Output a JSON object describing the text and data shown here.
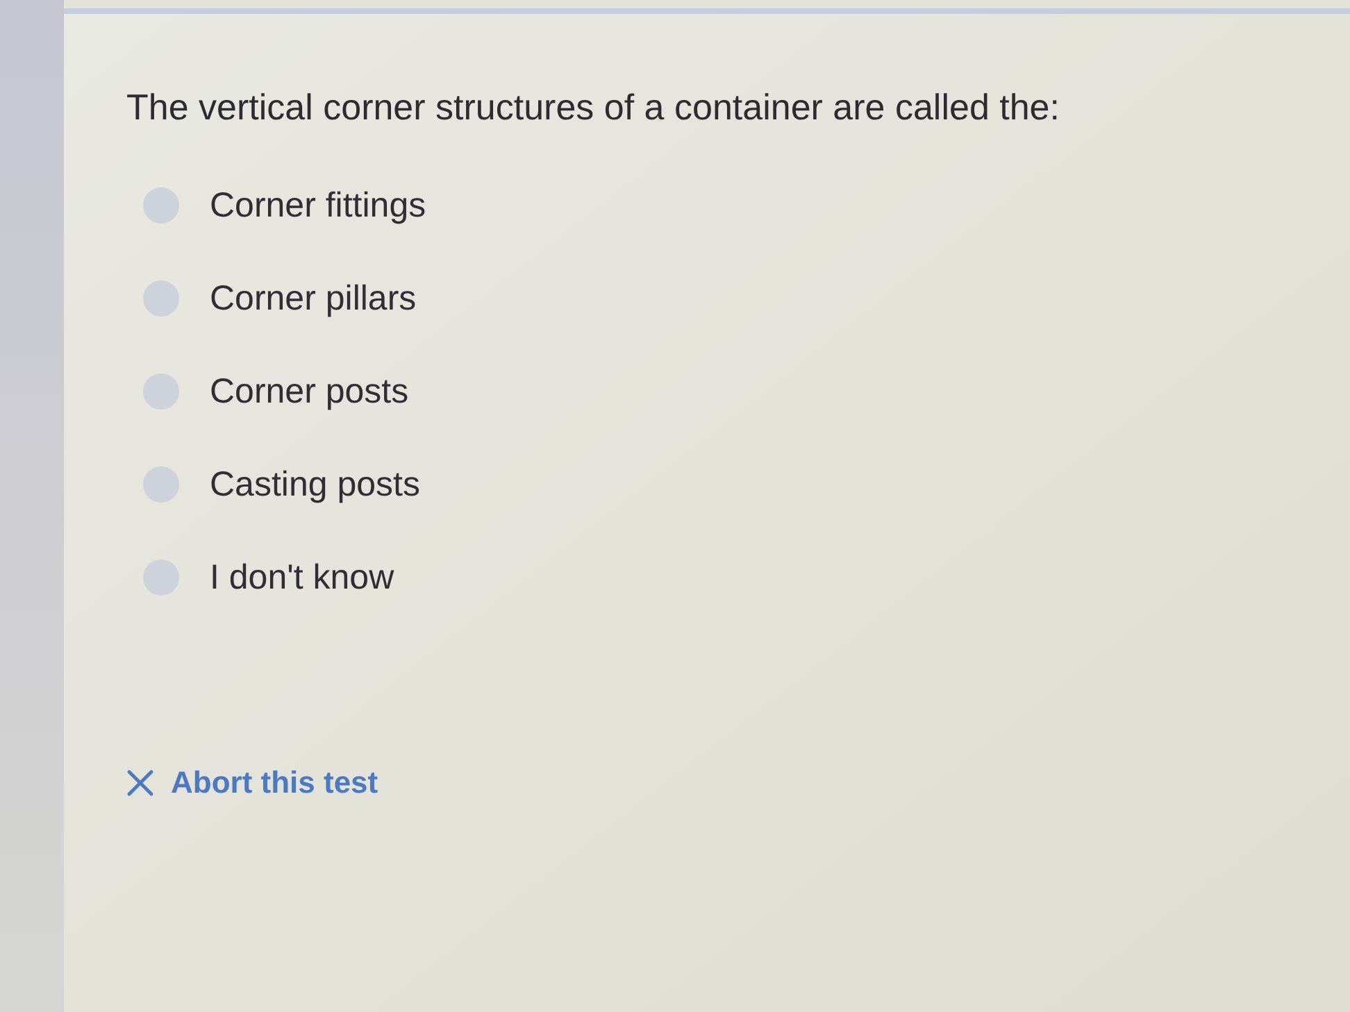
{
  "question": {
    "text": "The vertical corner structures of a container are called the:"
  },
  "options": [
    {
      "label": "Corner fittings",
      "selected": false
    },
    {
      "label": "Corner pillars",
      "selected": false
    },
    {
      "label": "Corner posts",
      "selected": false
    },
    {
      "label": "Casting posts",
      "selected": false
    },
    {
      "label": "I don't know",
      "selected": false
    }
  ],
  "abort_link": {
    "label": "Abort this test"
  }
}
